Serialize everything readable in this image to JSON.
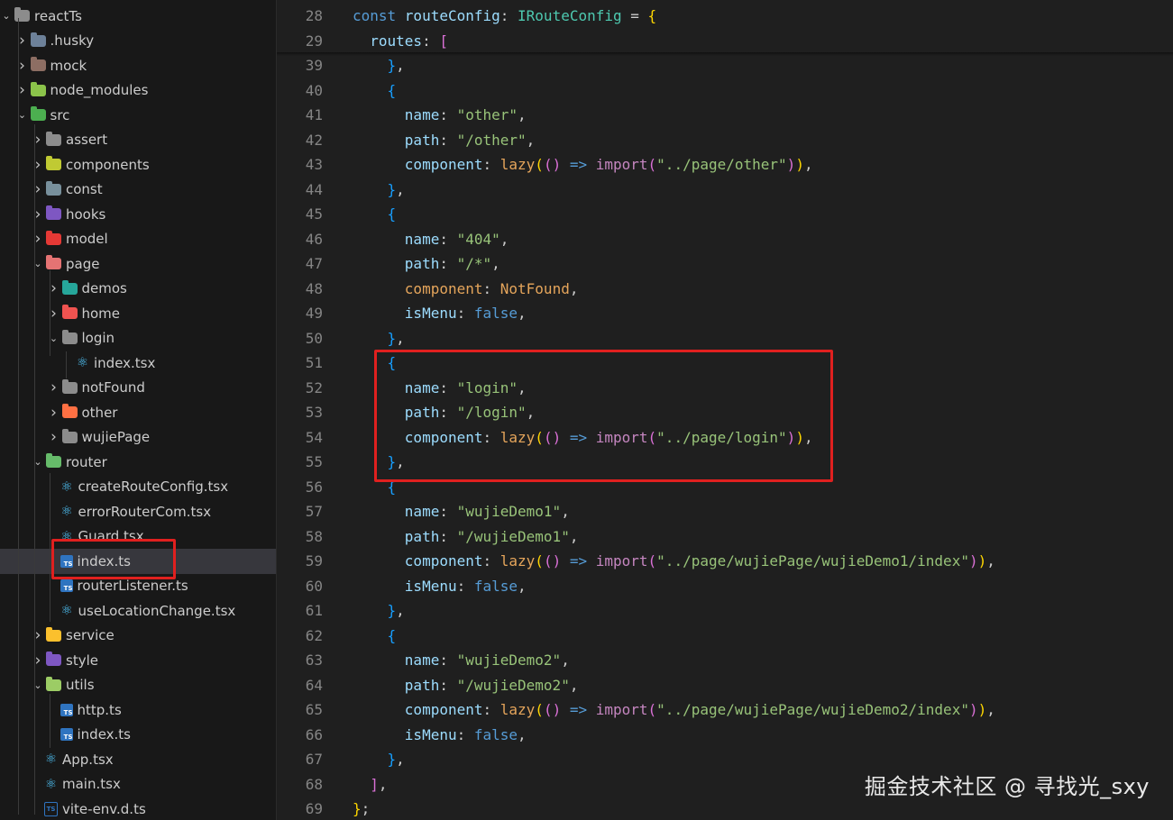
{
  "explorer": {
    "items": [
      {
        "label": "reactTs",
        "depth": 0,
        "type": "folder",
        "open": true,
        "color": "#8c8c8c"
      },
      {
        "label": ".husky",
        "depth": 1,
        "type": "folder",
        "open": false,
        "color": "#6d8199"
      },
      {
        "label": "mock",
        "depth": 1,
        "type": "folder",
        "open": false,
        "color": "#8d6e63"
      },
      {
        "label": "node_modules",
        "depth": 1,
        "type": "folder",
        "open": false,
        "color": "#8bc34a"
      },
      {
        "label": "src",
        "depth": 1,
        "type": "folder",
        "open": true,
        "color": "#4caf50"
      },
      {
        "label": "assert",
        "depth": 2,
        "type": "folder",
        "open": false,
        "color": "#8c8c8c"
      },
      {
        "label": "components",
        "depth": 2,
        "type": "folder",
        "open": false,
        "color": "#c0ca33"
      },
      {
        "label": "const",
        "depth": 2,
        "type": "folder",
        "open": false,
        "color": "#78909c"
      },
      {
        "label": "hooks",
        "depth": 2,
        "type": "folder",
        "open": false,
        "color": "#7e57c2"
      },
      {
        "label": "model",
        "depth": 2,
        "type": "folder",
        "open": false,
        "color": "#e53935"
      },
      {
        "label": "page",
        "depth": 2,
        "type": "folder",
        "open": true,
        "color": "#e57373"
      },
      {
        "label": "demos",
        "depth": 3,
        "type": "folder",
        "open": false,
        "color": "#26a69a"
      },
      {
        "label": "home",
        "depth": 3,
        "type": "folder",
        "open": false,
        "color": "#ef5350"
      },
      {
        "label": "login",
        "depth": 3,
        "type": "folder",
        "open": true,
        "color": "#8c8c8c"
      },
      {
        "label": "index.tsx",
        "depth": 4,
        "type": "react"
      },
      {
        "label": "notFound",
        "depth": 3,
        "type": "folder",
        "open": false,
        "color": "#8c8c8c"
      },
      {
        "label": "other",
        "depth": 3,
        "type": "folder",
        "open": false,
        "color": "#ff7043"
      },
      {
        "label": "wujiePage",
        "depth": 3,
        "type": "folder",
        "open": false,
        "color": "#8c8c8c"
      },
      {
        "label": "router",
        "depth": 2,
        "type": "folder",
        "open": true,
        "color": "#66bb6a"
      },
      {
        "label": "createRouteConfig.tsx",
        "depth": 3,
        "type": "react"
      },
      {
        "label": "errorRouterCom.tsx",
        "depth": 3,
        "type": "react"
      },
      {
        "label": "Guard.tsx",
        "depth": 3,
        "type": "react"
      },
      {
        "label": "index.ts",
        "depth": 3,
        "type": "ts",
        "selected": true
      },
      {
        "label": "routerListener.ts",
        "depth": 3,
        "type": "ts"
      },
      {
        "label": "useLocationChange.tsx",
        "depth": 3,
        "type": "react"
      },
      {
        "label": "service",
        "depth": 2,
        "type": "folder",
        "open": false,
        "color": "#fbc02d"
      },
      {
        "label": "style",
        "depth": 2,
        "type": "folder",
        "open": false,
        "color": "#7e57c2"
      },
      {
        "label": "utils",
        "depth": 2,
        "type": "folder",
        "open": true,
        "color": "#9ccc65"
      },
      {
        "label": "http.ts",
        "depth": 3,
        "type": "ts"
      },
      {
        "label": "index.ts",
        "depth": 3,
        "type": "ts"
      },
      {
        "label": "App.tsx",
        "depth": 2,
        "type": "react"
      },
      {
        "label": "main.tsx",
        "depth": 2,
        "type": "react"
      },
      {
        "label": "vite-env.d.ts",
        "depth": 2,
        "type": "dts"
      }
    ]
  },
  "editor": {
    "lines": [
      {
        "n": "28",
        "tokens": [
          [
            "const ",
            "kw"
          ],
          [
            "routeConfig",
            "var"
          ],
          [
            ": ",
            "punc"
          ],
          [
            "IRouteConfig",
            "type"
          ],
          [
            " = ",
            "punc"
          ],
          [
            "{",
            "br1"
          ]
        ]
      },
      {
        "n": "29",
        "tokens": [
          [
            "  routes",
            "prop"
          ],
          [
            ": ",
            "punc"
          ],
          [
            "[",
            "br2"
          ]
        ]
      },
      {
        "n": "39",
        "tokens": [
          [
            "    ",
            "punc"
          ],
          [
            "}",
            "br3"
          ],
          [
            ",",
            "punc"
          ]
        ]
      },
      {
        "n": "40",
        "tokens": [
          [
            "    ",
            "punc"
          ],
          [
            "{",
            "br3"
          ]
        ]
      },
      {
        "n": "41",
        "tokens": [
          [
            "      name",
            "prop"
          ],
          [
            ": ",
            "punc"
          ],
          [
            "\"other\"",
            "str2"
          ],
          [
            ",",
            "punc"
          ]
        ]
      },
      {
        "n": "42",
        "tokens": [
          [
            "      path",
            "prop"
          ],
          [
            ": ",
            "punc"
          ],
          [
            "\"/other\"",
            "str2"
          ],
          [
            ",",
            "punc"
          ]
        ]
      },
      {
        "n": "43",
        "tokens": [
          [
            "      component",
            "prop"
          ],
          [
            ": ",
            "punc"
          ],
          [
            "lazy",
            "orange"
          ],
          [
            "(",
            "br1"
          ],
          [
            "()",
            "br2"
          ],
          [
            " => ",
            "arrow"
          ],
          [
            "import",
            "imp"
          ],
          [
            "(",
            "br2"
          ],
          [
            "\"../page/other\"",
            "str2"
          ],
          [
            ")",
            "br2"
          ],
          [
            ")",
            "br1"
          ],
          [
            ",",
            "punc"
          ]
        ]
      },
      {
        "n": "44",
        "tokens": [
          [
            "    ",
            "punc"
          ],
          [
            "}",
            "br3"
          ],
          [
            ",",
            "punc"
          ]
        ]
      },
      {
        "n": "45",
        "tokens": [
          [
            "    ",
            "punc"
          ],
          [
            "{",
            "br3"
          ]
        ]
      },
      {
        "n": "46",
        "tokens": [
          [
            "      name",
            "prop"
          ],
          [
            ": ",
            "punc"
          ],
          [
            "\"404\"",
            "str2"
          ],
          [
            ",",
            "punc"
          ]
        ]
      },
      {
        "n": "47",
        "tokens": [
          [
            "      path",
            "prop"
          ],
          [
            ": ",
            "punc"
          ],
          [
            "\"/*\"",
            "str2"
          ],
          [
            ",",
            "punc"
          ]
        ]
      },
      {
        "n": "48",
        "tokens": [
          [
            "      component",
            "orange"
          ],
          [
            ": ",
            "punc"
          ],
          [
            "NotFound",
            "orange"
          ],
          [
            ",",
            "punc"
          ]
        ]
      },
      {
        "n": "49",
        "tokens": [
          [
            "      isMenu",
            "prop"
          ],
          [
            ": ",
            "punc"
          ],
          [
            "false",
            "bool"
          ],
          [
            ",",
            "punc"
          ]
        ]
      },
      {
        "n": "50",
        "tokens": [
          [
            "    ",
            "punc"
          ],
          [
            "}",
            "br3"
          ],
          [
            ",",
            "punc"
          ]
        ]
      },
      {
        "n": "51",
        "tokens": [
          [
            "    ",
            "punc"
          ],
          [
            "{",
            "br3"
          ]
        ]
      },
      {
        "n": "52",
        "tokens": [
          [
            "      name",
            "prop"
          ],
          [
            ": ",
            "punc"
          ],
          [
            "\"login\"",
            "str2"
          ],
          [
            ",",
            "punc"
          ]
        ]
      },
      {
        "n": "53",
        "tokens": [
          [
            "      path",
            "prop"
          ],
          [
            ": ",
            "punc"
          ],
          [
            "\"/login\"",
            "str2"
          ],
          [
            ",",
            "punc"
          ]
        ]
      },
      {
        "n": "54",
        "tokens": [
          [
            "      component",
            "prop"
          ],
          [
            ": ",
            "punc"
          ],
          [
            "lazy",
            "orange"
          ],
          [
            "(",
            "br1"
          ],
          [
            "()",
            "br2"
          ],
          [
            " => ",
            "arrow"
          ],
          [
            "import",
            "imp"
          ],
          [
            "(",
            "br2"
          ],
          [
            "\"../page/login\"",
            "str2"
          ],
          [
            ")",
            "br2"
          ],
          [
            ")",
            "br1"
          ],
          [
            ",",
            "punc"
          ]
        ]
      },
      {
        "n": "55",
        "tokens": [
          [
            "    ",
            "punc"
          ],
          [
            "}",
            "br3"
          ],
          [
            ",",
            "punc"
          ]
        ]
      },
      {
        "n": "56",
        "tokens": [
          [
            "    ",
            "punc"
          ],
          [
            "{",
            "br3"
          ]
        ]
      },
      {
        "n": "57",
        "tokens": [
          [
            "      name",
            "prop"
          ],
          [
            ": ",
            "punc"
          ],
          [
            "\"wujieDemo1\"",
            "str2"
          ],
          [
            ",",
            "punc"
          ]
        ]
      },
      {
        "n": "58",
        "tokens": [
          [
            "      path",
            "prop"
          ],
          [
            ": ",
            "punc"
          ],
          [
            "\"/wujieDemo1\"",
            "str2"
          ],
          [
            ",",
            "punc"
          ]
        ]
      },
      {
        "n": "59",
        "tokens": [
          [
            "      component",
            "prop"
          ],
          [
            ": ",
            "punc"
          ],
          [
            "lazy",
            "orange"
          ],
          [
            "(",
            "br1"
          ],
          [
            "()",
            "br2"
          ],
          [
            " => ",
            "arrow"
          ],
          [
            "import",
            "imp"
          ],
          [
            "(",
            "br2"
          ],
          [
            "\"../page/wujiePage/wujieDemo1/index\"",
            "str2"
          ],
          [
            ")",
            "br2"
          ],
          [
            ")",
            "br1"
          ],
          [
            ",",
            "punc"
          ]
        ]
      },
      {
        "n": "60",
        "tokens": [
          [
            "      isMenu",
            "prop"
          ],
          [
            ": ",
            "punc"
          ],
          [
            "false",
            "bool"
          ],
          [
            ",",
            "punc"
          ]
        ]
      },
      {
        "n": "61",
        "tokens": [
          [
            "    ",
            "punc"
          ],
          [
            "}",
            "br3"
          ],
          [
            ",",
            "punc"
          ]
        ]
      },
      {
        "n": "62",
        "tokens": [
          [
            "    ",
            "punc"
          ],
          [
            "{",
            "br3"
          ]
        ]
      },
      {
        "n": "63",
        "tokens": [
          [
            "      name",
            "prop"
          ],
          [
            ": ",
            "punc"
          ],
          [
            "\"wujieDemo2\"",
            "str2"
          ],
          [
            ",",
            "punc"
          ]
        ]
      },
      {
        "n": "64",
        "tokens": [
          [
            "      path",
            "prop"
          ],
          [
            ": ",
            "punc"
          ],
          [
            "\"/wujieDemo2\"",
            "str2"
          ],
          [
            ",",
            "punc"
          ]
        ]
      },
      {
        "n": "65",
        "tokens": [
          [
            "      component",
            "prop"
          ],
          [
            ": ",
            "punc"
          ],
          [
            "lazy",
            "orange"
          ],
          [
            "(",
            "br1"
          ],
          [
            "()",
            "br2"
          ],
          [
            " => ",
            "arrow"
          ],
          [
            "import",
            "imp"
          ],
          [
            "(",
            "br2"
          ],
          [
            "\"../page/wujiePage/wujieDemo2/index\"",
            "str2"
          ],
          [
            ")",
            "br2"
          ],
          [
            ")",
            "br1"
          ],
          [
            ",",
            "punc"
          ]
        ]
      },
      {
        "n": "66",
        "tokens": [
          [
            "      isMenu",
            "prop"
          ],
          [
            ": ",
            "punc"
          ],
          [
            "false",
            "bool"
          ],
          [
            ",",
            "punc"
          ]
        ]
      },
      {
        "n": "67",
        "tokens": [
          [
            "    ",
            "punc"
          ],
          [
            "}",
            "br3"
          ],
          [
            ",",
            "punc"
          ]
        ]
      },
      {
        "n": "68",
        "tokens": [
          [
            "  ",
            "punc"
          ],
          [
            "]",
            "br2"
          ],
          [
            ",",
            "punc"
          ]
        ]
      },
      {
        "n": "69",
        "tokens": [
          [
            "}",
            "br1"
          ],
          [
            ";",
            "punc"
          ]
        ]
      }
    ]
  },
  "watermark": "掘金技术社区 @ 寻找光_sxy",
  "colors": {
    "highlight": "#e0201f",
    "selection": "#37373d"
  }
}
